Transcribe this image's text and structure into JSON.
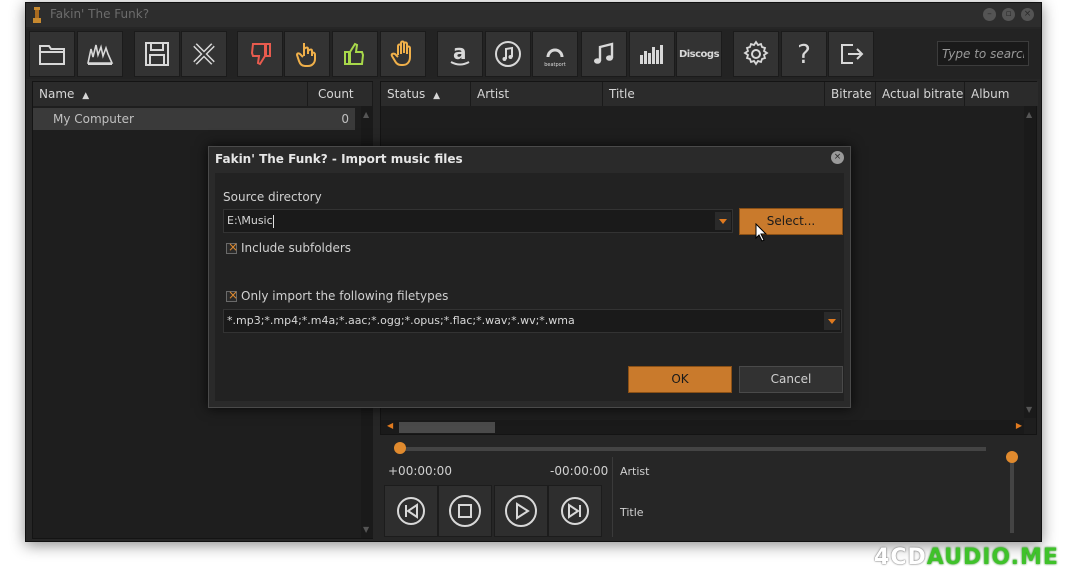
{
  "window": {
    "title": "Fakin' The Funk?"
  },
  "toolbar": {
    "search_placeholder": "Type to search",
    "buttons": [
      {
        "name": "open-folder-button",
        "icon": "folder-icon"
      },
      {
        "name": "spectrum-button",
        "icon": "spectrum-icon"
      },
      {
        "name": "save-button",
        "icon": "save-icon"
      },
      {
        "name": "remove-button",
        "icon": "close-x-icon"
      },
      {
        "name": "thumbs-down-button",
        "icon": "thumbs-down-icon"
      },
      {
        "name": "hand-point-button",
        "icon": "hand-point-icon"
      },
      {
        "name": "thumbs-up-button",
        "icon": "thumbs-up-icon"
      },
      {
        "name": "hand-stop-button",
        "icon": "hand-stop-icon"
      },
      {
        "name": "amazon-button",
        "icon": "amazon-icon"
      },
      {
        "name": "apple-music-button",
        "icon": "music-note-circle-icon"
      },
      {
        "name": "beatport-button",
        "icon": "beatport-icon",
        "label": "beatport"
      },
      {
        "name": "music-button",
        "icon": "music-notes-icon"
      },
      {
        "name": "equalizer-button",
        "icon": "equalizer-icon"
      },
      {
        "name": "discogs-button",
        "icon": "discogs-icon",
        "label": "Discogs"
      },
      {
        "name": "settings-button",
        "icon": "gear-icon"
      },
      {
        "name": "help-button",
        "icon": "question-icon"
      },
      {
        "name": "exit-button",
        "icon": "exit-icon"
      }
    ]
  },
  "left_panel": {
    "columns": {
      "name": "Name",
      "count": "Count"
    },
    "rows": [
      {
        "name": "My Computer",
        "count": "0"
      }
    ]
  },
  "right_panel": {
    "columns": {
      "status": "Status",
      "artist": "Artist",
      "title": "Title",
      "bitrate": "Bitrate",
      "actual_bitrate": "Actual bitrate",
      "album": "Album"
    }
  },
  "player": {
    "time_elapsed": "+00:00:00",
    "time_remaining": "-00:00:00",
    "artist_label": "Artist",
    "title_label": "Title"
  },
  "dialog": {
    "title": "Fakin' The Funk? - Import music files",
    "source_label": "Source directory",
    "source_value": "E:\\Music",
    "select_button": "Select...",
    "include_subfolders": "Include subfolders",
    "filetypes_label": "Only import the following filetypes",
    "filetypes_value": "*.mp3;*.mp4;*.m4a;*.aac;*.ogg;*.opus;*.flac;*.wav;*.wv;*.wma",
    "ok_button": "OK",
    "cancel_button": "Cancel"
  },
  "watermark": {
    "prefix": "4",
    "part1": "CD",
    "part2": "AUDIO.ME"
  },
  "colors": {
    "accent": "#e07a1f",
    "background": "#262626",
    "panel": "#1e1e1e"
  }
}
